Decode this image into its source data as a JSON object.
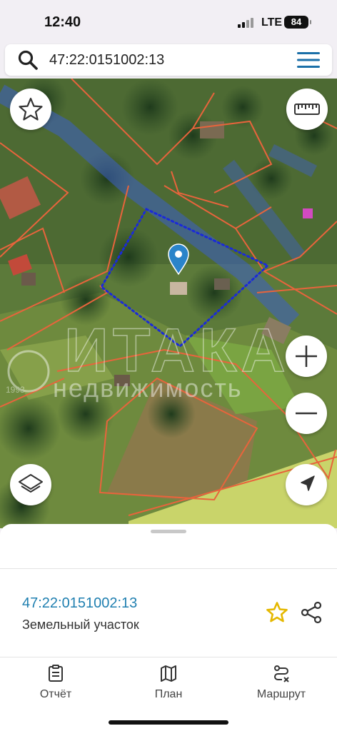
{
  "status": {
    "time": "12:40",
    "network": "LTE",
    "battery": "84"
  },
  "search": {
    "value": "47:22:0151002:13",
    "search_icon": "search-icon",
    "menu_icon": "hamburger-menu-icon"
  },
  "map": {
    "watermark_logo": "ИТАКА",
    "watermark_text": "недвижимость",
    "watermark_year": "1993",
    "controls": [
      "star-icon",
      "ruler-icon",
      "zoom-in-icon",
      "zoom-out-icon",
      "layers-icon",
      "location-arrow-icon"
    ],
    "colors": {
      "parcel_border": "#e8643c",
      "selected_parcel": "#1a2ad8",
      "road_overlay": "#3d5fc8",
      "pin": "#2a84c9"
    }
  },
  "sheet": {
    "parcel_id": "47:22:0151002:13",
    "parcel_type": "Земельный участок",
    "favorite_color": "#e5b800"
  },
  "tabs": [
    {
      "label": "Отчёт",
      "icon": "report-clipboard-icon"
    },
    {
      "label": "План",
      "icon": "map-plan-icon"
    },
    {
      "label": "Маршрут",
      "icon": "route-icon"
    }
  ]
}
